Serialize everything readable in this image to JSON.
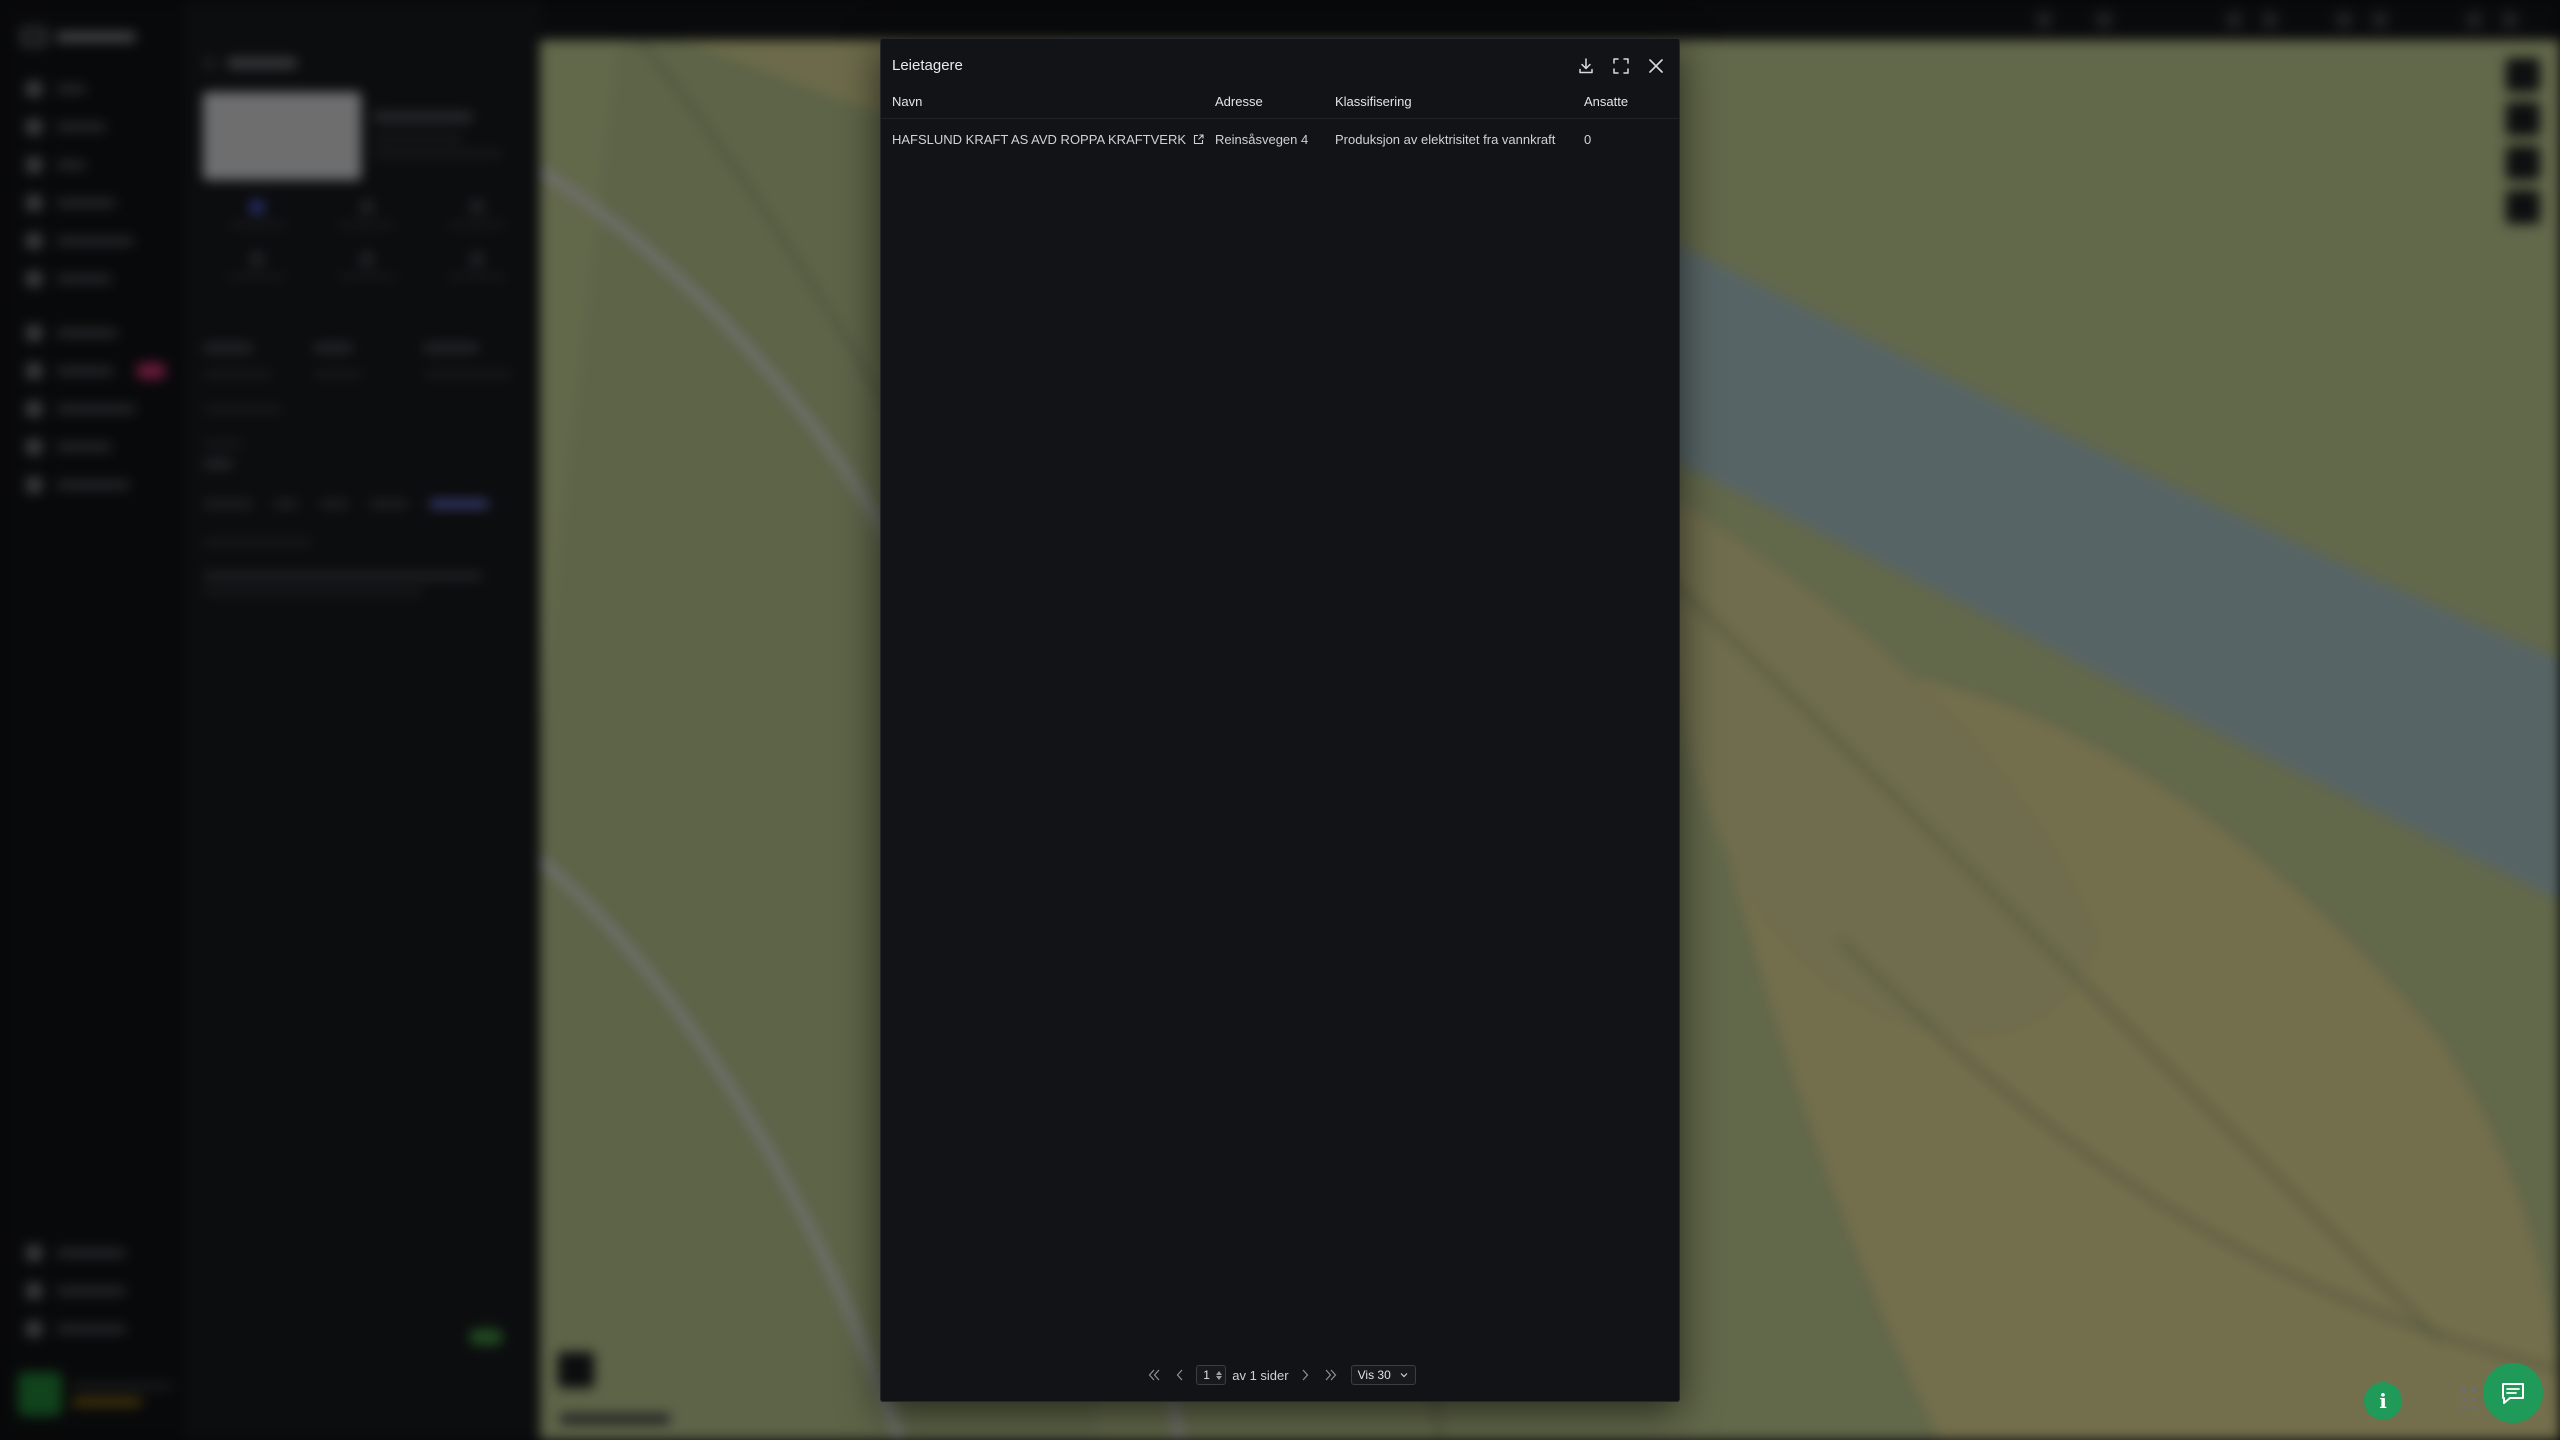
{
  "modal": {
    "title": "Leietagere",
    "actions": {
      "download_icon": "download-icon",
      "fullscreen_icon": "expand-icon",
      "close_icon": "close-icon"
    },
    "table": {
      "headers": {
        "name": "Navn",
        "address": "Adresse",
        "classification": "Klassifisering",
        "employees": "Ansatte"
      },
      "rows": [
        {
          "name": "HAFSLUND KRAFT AS AVD ROPPA KRAFTVERK",
          "address": "Reinsåsvegen 4",
          "classification": "Produksjon av elektrisitet fra vannkraft",
          "employees": "0"
        }
      ]
    },
    "pagination": {
      "page": "1",
      "of_pages": "av 1 sider",
      "page_size": "Vis 30"
    }
  },
  "colors": {
    "modal_bg": "#121316",
    "accent_green": "#1f9a58",
    "map_land": "#b7be87",
    "map_water": "#9fb7b8"
  },
  "floating": {
    "info_label": "i"
  }
}
